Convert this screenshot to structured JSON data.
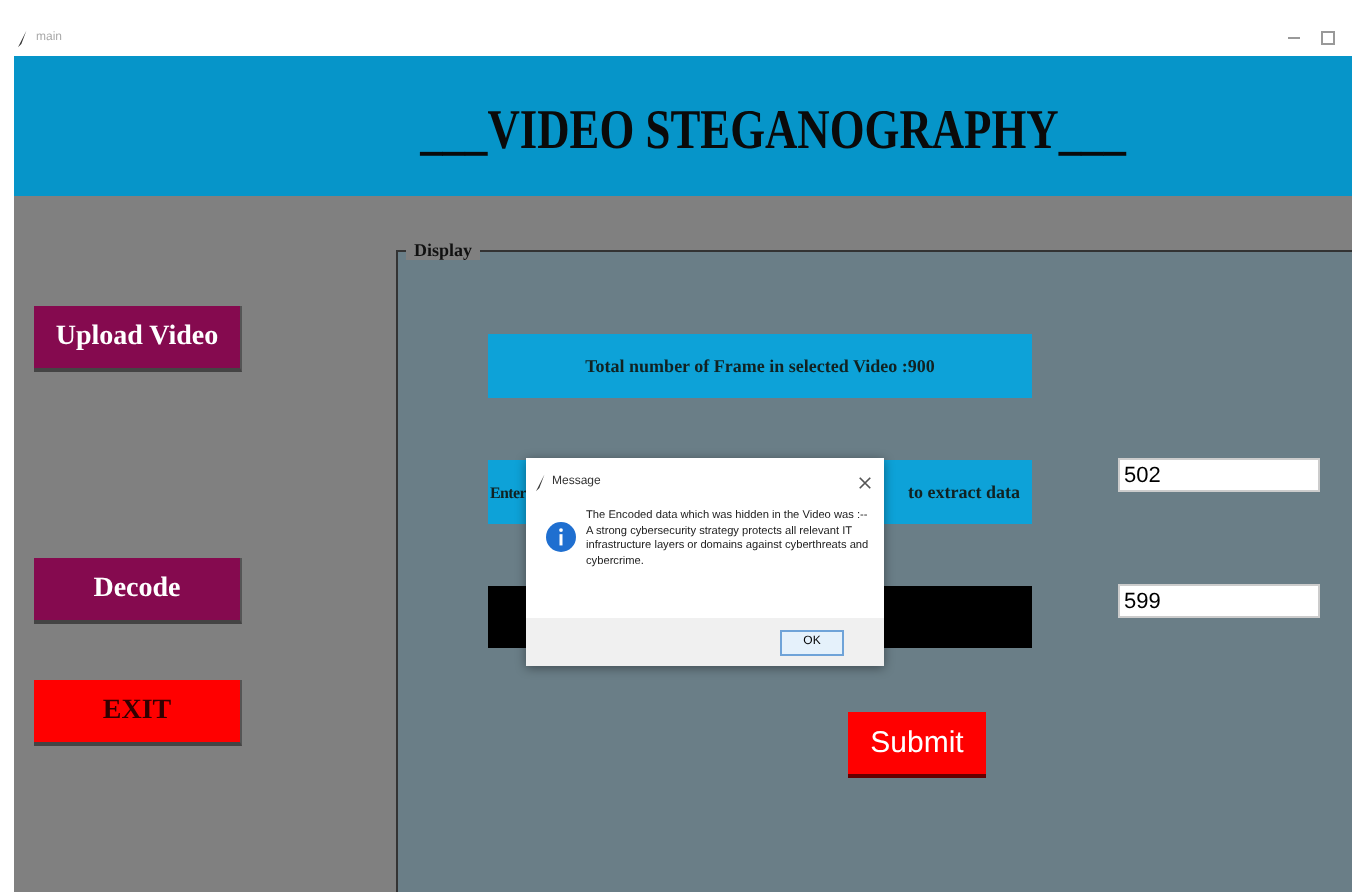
{
  "window": {
    "title": "main"
  },
  "header": {
    "title": "___VIDEO STEGANOGRAPHY___"
  },
  "sidebar": {
    "buttons": [
      {
        "label": "Upload Video",
        "kind": "primary"
      },
      {
        "label": "Decode",
        "kind": "primary"
      },
      {
        "label": "EXIT",
        "kind": "danger"
      }
    ]
  },
  "display": {
    "legend": "Display",
    "frames_label": "Total number of Frame in selected Video :900",
    "range_label": {
      "left": "Enter",
      "right": "to extract data"
    },
    "start_frame": {
      "value": "502"
    },
    "end_frame": {
      "value": "599"
    },
    "submit": "Submit"
  },
  "dialog": {
    "title": "Message",
    "message": "The Encoded data which was hidden in the Video was :--A strong cybersecurity strategy protects all relevant IT infrastructure layers or domains against cyberthreats and cybercrime.",
    "button": "OK"
  }
}
